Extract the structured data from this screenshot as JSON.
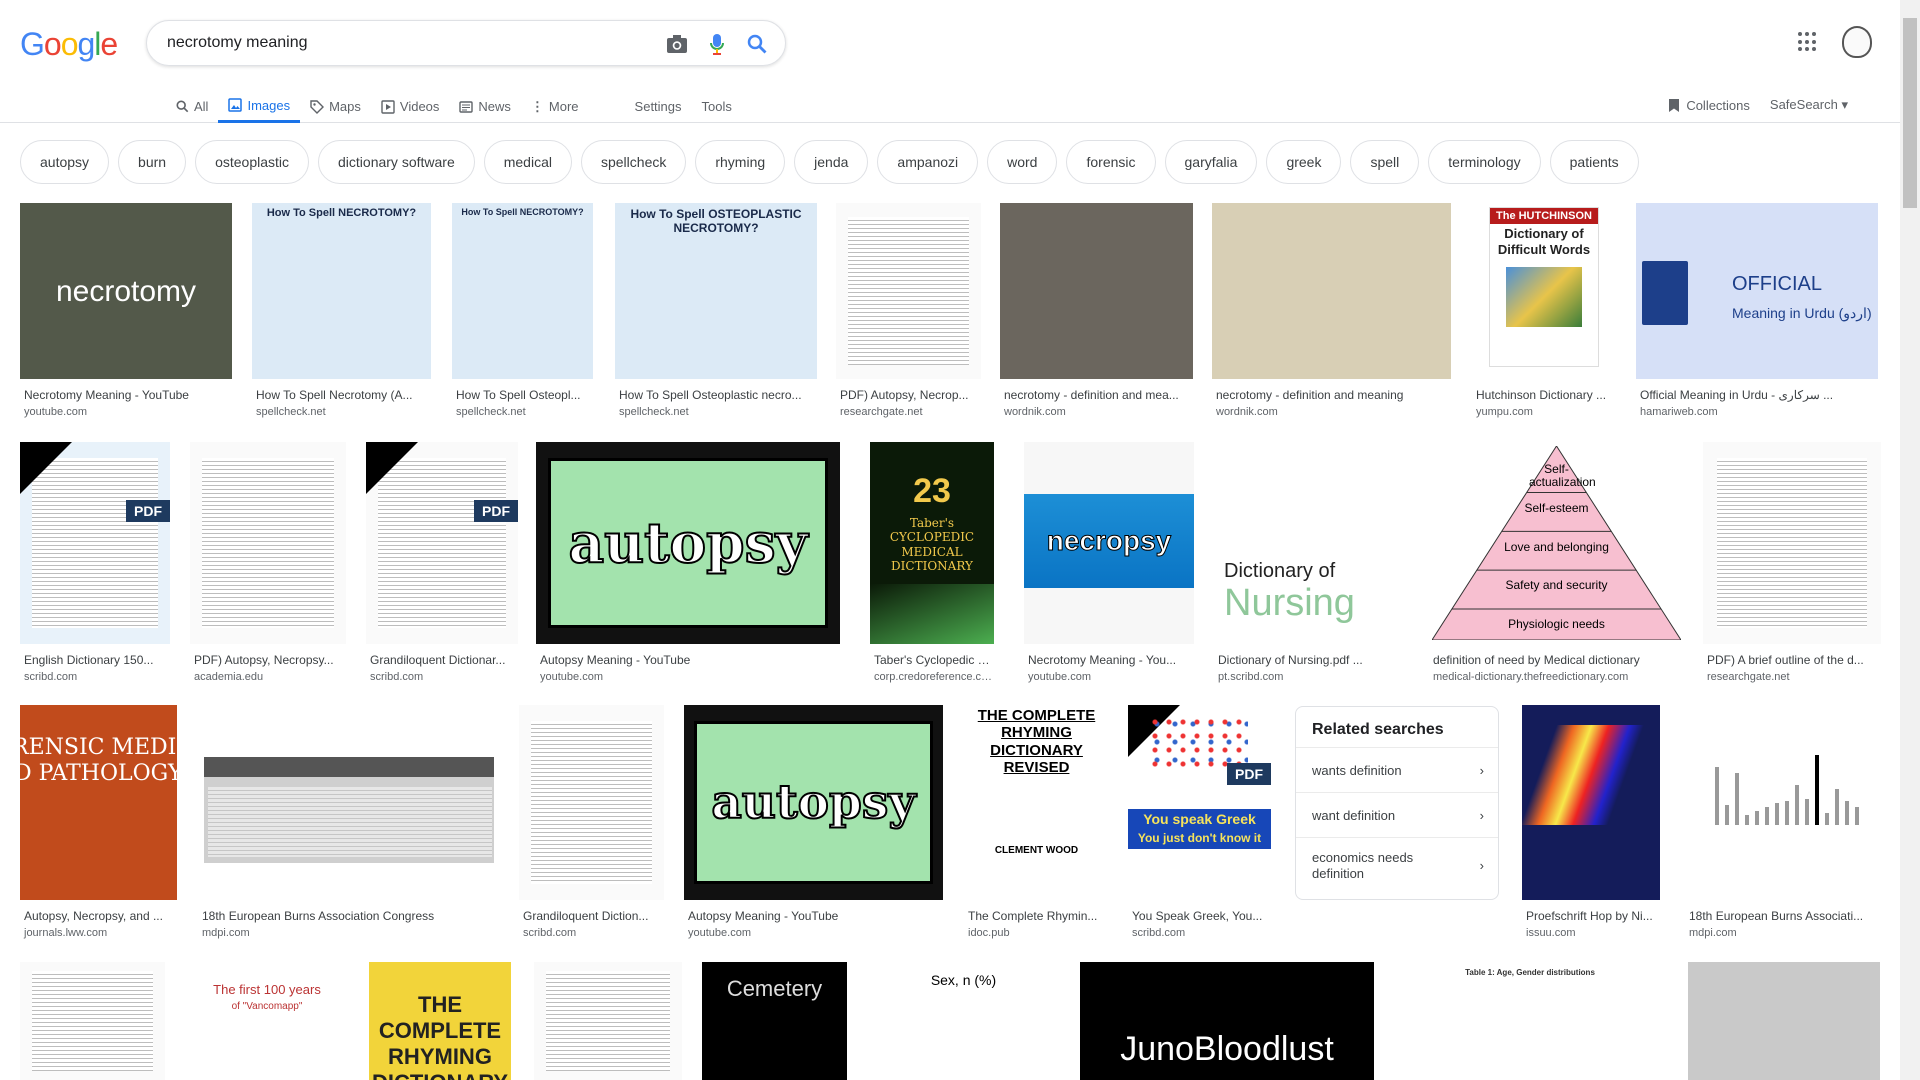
{
  "logo": [
    "G",
    "o",
    "o",
    "g",
    "l",
    "e"
  ],
  "search": {
    "query": "necrotomy meaning"
  },
  "tabs": [
    {
      "label": "All"
    },
    {
      "label": "Images"
    },
    {
      "label": "Maps"
    },
    {
      "label": "Videos"
    },
    {
      "label": "News"
    },
    {
      "label": "More"
    }
  ],
  "tools": {
    "settings": "Settings",
    "tools": "Tools"
  },
  "right": {
    "collections": "Collections",
    "safesearch": "SafeSearch"
  },
  "chips": [
    "autopsy",
    "burn",
    "osteoplastic",
    "dictionary software",
    "medical",
    "spellcheck",
    "rhyming",
    "jenda",
    "ampanozi",
    "word",
    "forensic",
    "garyfalia",
    "greek",
    "spell",
    "terminology",
    "patients"
  ],
  "results": {
    "r1": [
      {
        "title": "Necrotomy Meaning - YouTube",
        "source": "youtube.com",
        "img_text": "necrotomy"
      },
      {
        "title": "How To Spell Necrotomy (A...",
        "source": "spellcheck.net",
        "img_text": "How To Spell NECROTOMY?"
      },
      {
        "title": "How To Spell Osteopl...",
        "source": "spellcheck.net",
        "img_text": "How To Spell NECROTOMY?"
      },
      {
        "title": "How To Spell Osteoplastic necro...",
        "source": "spellcheck.net",
        "img_text": "How To Spell OSTEOPLASTIC NECROTOMY?"
      },
      {
        "title": "PDF) Autopsy, Necrop...",
        "source": "researchgate.net"
      },
      {
        "title": "necrotomy - definition and mea...",
        "source": "wordnik.com"
      },
      {
        "title": "necrotomy - definition and meaning",
        "source": "wordnik.com"
      },
      {
        "title": "Hutchinson Dictionary ...",
        "source": "yumpu.com",
        "img_text": "Dictionary of Difficult Words",
        "img_brand": "The HUTCHINSON"
      },
      {
        "title": "Official Meaning in Urdu - سرکاری ...",
        "source": "hamariweb.com",
        "img_text": "OFFICIAL",
        "img_sub": "Meaning in Urdu (اردو)"
      }
    ],
    "r2": [
      {
        "title": "English Dictionary 150...",
        "source": "scribd.com",
        "badge": "PDF"
      },
      {
        "title": "PDF) Autopsy, Necropsy...",
        "source": "academia.edu"
      },
      {
        "title": "Grandiloquent Dictionar...",
        "source": "scribd.com",
        "badge": "PDF"
      },
      {
        "title": "Autopsy Meaning - YouTube",
        "source": "youtube.com",
        "img_text": "autopsy"
      },
      {
        "title": "Taber's Cyclopedic Me...",
        "source": "corp.credoreference.com",
        "img_text": "23",
        "img_sub": "Taber's CYCLOPEDIC MEDICAL DICTIONARY"
      },
      {
        "title": "Necrotomy Meaning - You...",
        "source": "youtube.com",
        "img_text": "necropsy"
      },
      {
        "title": "Dictionary of Nursing.pdf ...",
        "source": "pt.scribd.com",
        "img_text": "Dictionary of",
        "img_sub": "Nursing"
      },
      {
        "title": "definition of need by Medical dictionary",
        "source": "medical-dictionary.thefreedictionary.com",
        "pyramid": [
          "Self-actualization",
          "Self-esteem",
          "Love and belonging",
          "Safety and security",
          "Physiologic needs"
        ]
      },
      {
        "title": "PDF) A brief outline of the d...",
        "source": "researchgate.net"
      }
    ],
    "r3": [
      {
        "title": "Autopsy, Necropsy, and ...",
        "source": "journals.lww.com",
        "img_text": "RENSIC MEDICINE",
        "img_sub": "D PATHOLOGY"
      },
      {
        "title": "18th European Burns Association Congress",
        "source": "mdpi.com"
      },
      {
        "title": "Grandiloquent Diction...",
        "source": "scribd.com"
      },
      {
        "title": "Autopsy Meaning - YouTube",
        "source": "youtube.com",
        "img_text": "autopsy"
      },
      {
        "title": "The Complete Rhymin...",
        "source": "idoc.pub",
        "img_text": "THE COMPLETE RHYMING DICTIONARY REVISED",
        "img_sub": "CLEMENT WOOD"
      },
      {
        "title": "You Speak Greek, You...",
        "source": "scribd.com",
        "img_text": "You speak Greek",
        "img_sub": "You just don't know it",
        "badge": "PDF"
      },
      {
        "title": "Proefschrift Hop by Ni...",
        "source": "issuu.com"
      },
      {
        "title": "18th European Burns Associati...",
        "source": "mdpi.com"
      }
    ],
    "r4": [
      {},
      {
        "img_text": "The first 100 years",
        "img_sub": "of \"Vancomapp\""
      },
      {
        "img_text": "THE COMPLETE RHYMING DICTIONARY"
      },
      {},
      {
        "img_text": "Cemetery"
      },
      {
        "img_text": "Sex, n (%)"
      },
      {
        "img_text": "JunoBloodlust"
      },
      {
        "img_text": "Table 1: Age, Gender distributions"
      },
      {}
    ]
  },
  "related": {
    "title": "Related searches",
    "items": [
      "wants definition",
      "want definition",
      "economics needs definition"
    ]
  }
}
